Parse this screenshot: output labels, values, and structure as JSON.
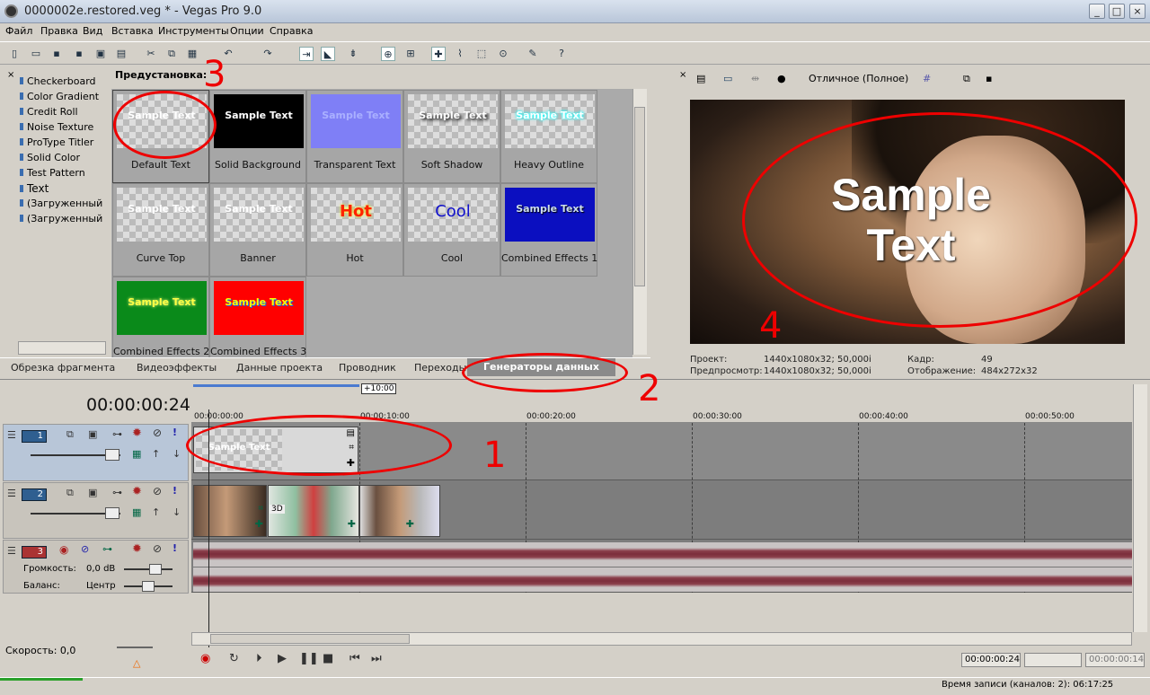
{
  "window": {
    "title": "0000002e.restored.veg * - Vegas Pro 9.0"
  },
  "menu": [
    "Файл",
    "Правка",
    "Вид",
    "Вставка",
    "Инструменты",
    "Опции",
    "Справка"
  ],
  "generators": {
    "list": [
      "Checkerboard",
      "Color Gradient",
      "Credit Roll",
      "Noise Texture",
      "ProType Titler",
      "Solid Color",
      "Test Pattern",
      "Text",
      "(Загруженный пл",
      "(Загруженный пл"
    ],
    "selected": "Text",
    "preset_label": "Предустановка:",
    "presets": [
      {
        "label": "Default Text",
        "thumb": "Sample Text"
      },
      {
        "label": "Solid Background",
        "thumb": "Sample Text"
      },
      {
        "label": "Transparent Text",
        "thumb": "Sample Text"
      },
      {
        "label": "Soft Shadow",
        "thumb": "Sample Text"
      },
      {
        "label": "Heavy Outline",
        "thumb": "Sample Text"
      },
      {
        "label": "Curve Top",
        "thumb": "Sample Text"
      },
      {
        "label": "Banner",
        "thumb": "Sample Text"
      },
      {
        "label": "Hot",
        "thumb": "Hot"
      },
      {
        "label": "Cool",
        "thumb": "Cool"
      },
      {
        "label": "Combined Effects 1",
        "thumb": "Sample Text"
      },
      {
        "label": "Combined Effects 2",
        "thumb": "Sample Text"
      },
      {
        "label": "Combined Effects 3",
        "thumb": "Sample Text"
      }
    ]
  },
  "tabs": [
    "Обрезка фрагмента",
    "Видеоэффекты",
    "Данные проекта",
    "Проводник",
    "Переходы",
    "Генераторы данных"
  ],
  "preview": {
    "quality": "Отличное (Полное)",
    "sample_text": "Sample Text",
    "info": {
      "project_label": "Проект:",
      "project_value": "1440x1080x32; 50,000i",
      "preview_label": "Предпросмотр:",
      "preview_value": "1440x1080x32; 50,000i",
      "frame_label": "Кадр:",
      "frame_value": "49",
      "display_label": "Отображение:",
      "display_value": "484x272x32"
    }
  },
  "timeline": {
    "timecode": "00:00:00:24",
    "region_label": "+10:00",
    "ruler": [
      "00:00:00:00",
      "00:00:10:00",
      "00:00:20:00",
      "00:00:30:00",
      "00:00:40:00",
      "00:00:50:00"
    ],
    "tracks": [
      {
        "num": "1",
        "kind": "video"
      },
      {
        "num": "2",
        "kind": "video"
      },
      {
        "num": "3",
        "kind": "audio",
        "volume_label": "Громкость:",
        "volume_value": "0,0 dB",
        "pan_label": "Баланс:",
        "pan_value": "Центр"
      }
    ],
    "text_clip": "Sample Text",
    "clip_3d": "3D",
    "speed": "Скорость: 0,0",
    "timecode_end": "00:00:00:24",
    "timecode_len": "00:00:00:14"
  },
  "status": {
    "record_time": "Время записи (каналов: 2): 06:17:25"
  },
  "annotations": [
    "1",
    "2",
    "3",
    "4"
  ]
}
